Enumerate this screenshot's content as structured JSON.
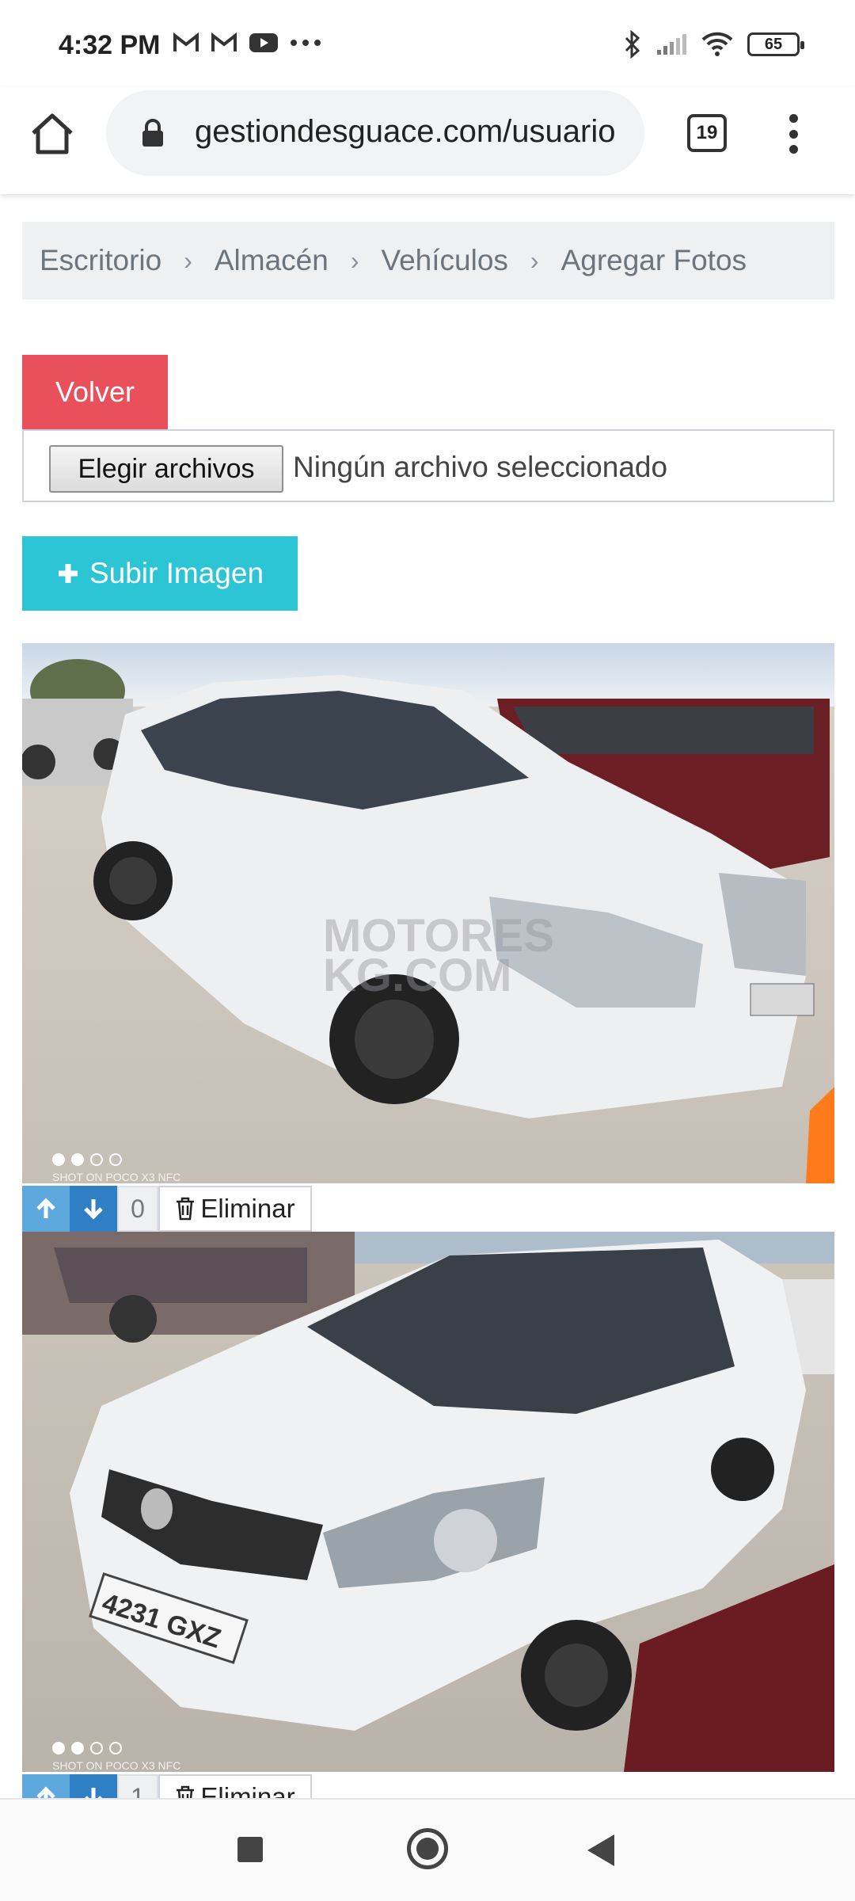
{
  "status_bar": {
    "time": "4:32 PM",
    "left_icons": [
      "gmail-icon",
      "gmail-icon",
      "youtube-icon",
      "more-dots-icon"
    ],
    "right_icons": [
      "bluetooth-icon",
      "signal-icon",
      "wifi-icon",
      "battery-icon"
    ],
    "battery": "65"
  },
  "browser": {
    "url": "gestiondesguace.com/usuario",
    "tab_count": "19"
  },
  "breadcrumb": {
    "items": [
      "Escritorio",
      "Almacén",
      "Vehículos",
      "Agregar Fotos"
    ],
    "separator": "›"
  },
  "form": {
    "back_label": "Volver",
    "choose_files_label": "Elegir archivos",
    "no_file_text": "Ningún archivo seleccionado",
    "upload_label": "Subir Imagen"
  },
  "photos": [
    {
      "index": "0",
      "delete_label": "Eliminar",
      "watermark": "MOTORES\nKG.COM",
      "shot_text": "SHOT ON POCO X3 NFC"
    },
    {
      "index": "1",
      "delete_label": "Eliminar",
      "plate": "4231 GXZ",
      "shot_text": "SHOT ON POCO X3 NFC"
    }
  ],
  "colors": {
    "volver": "#e8505b",
    "subir": "#2cc5d6",
    "arrow_up": "#5da8dc",
    "arrow_down": "#2f7fc4",
    "breadcrumb_bg": "#eef0f2"
  }
}
